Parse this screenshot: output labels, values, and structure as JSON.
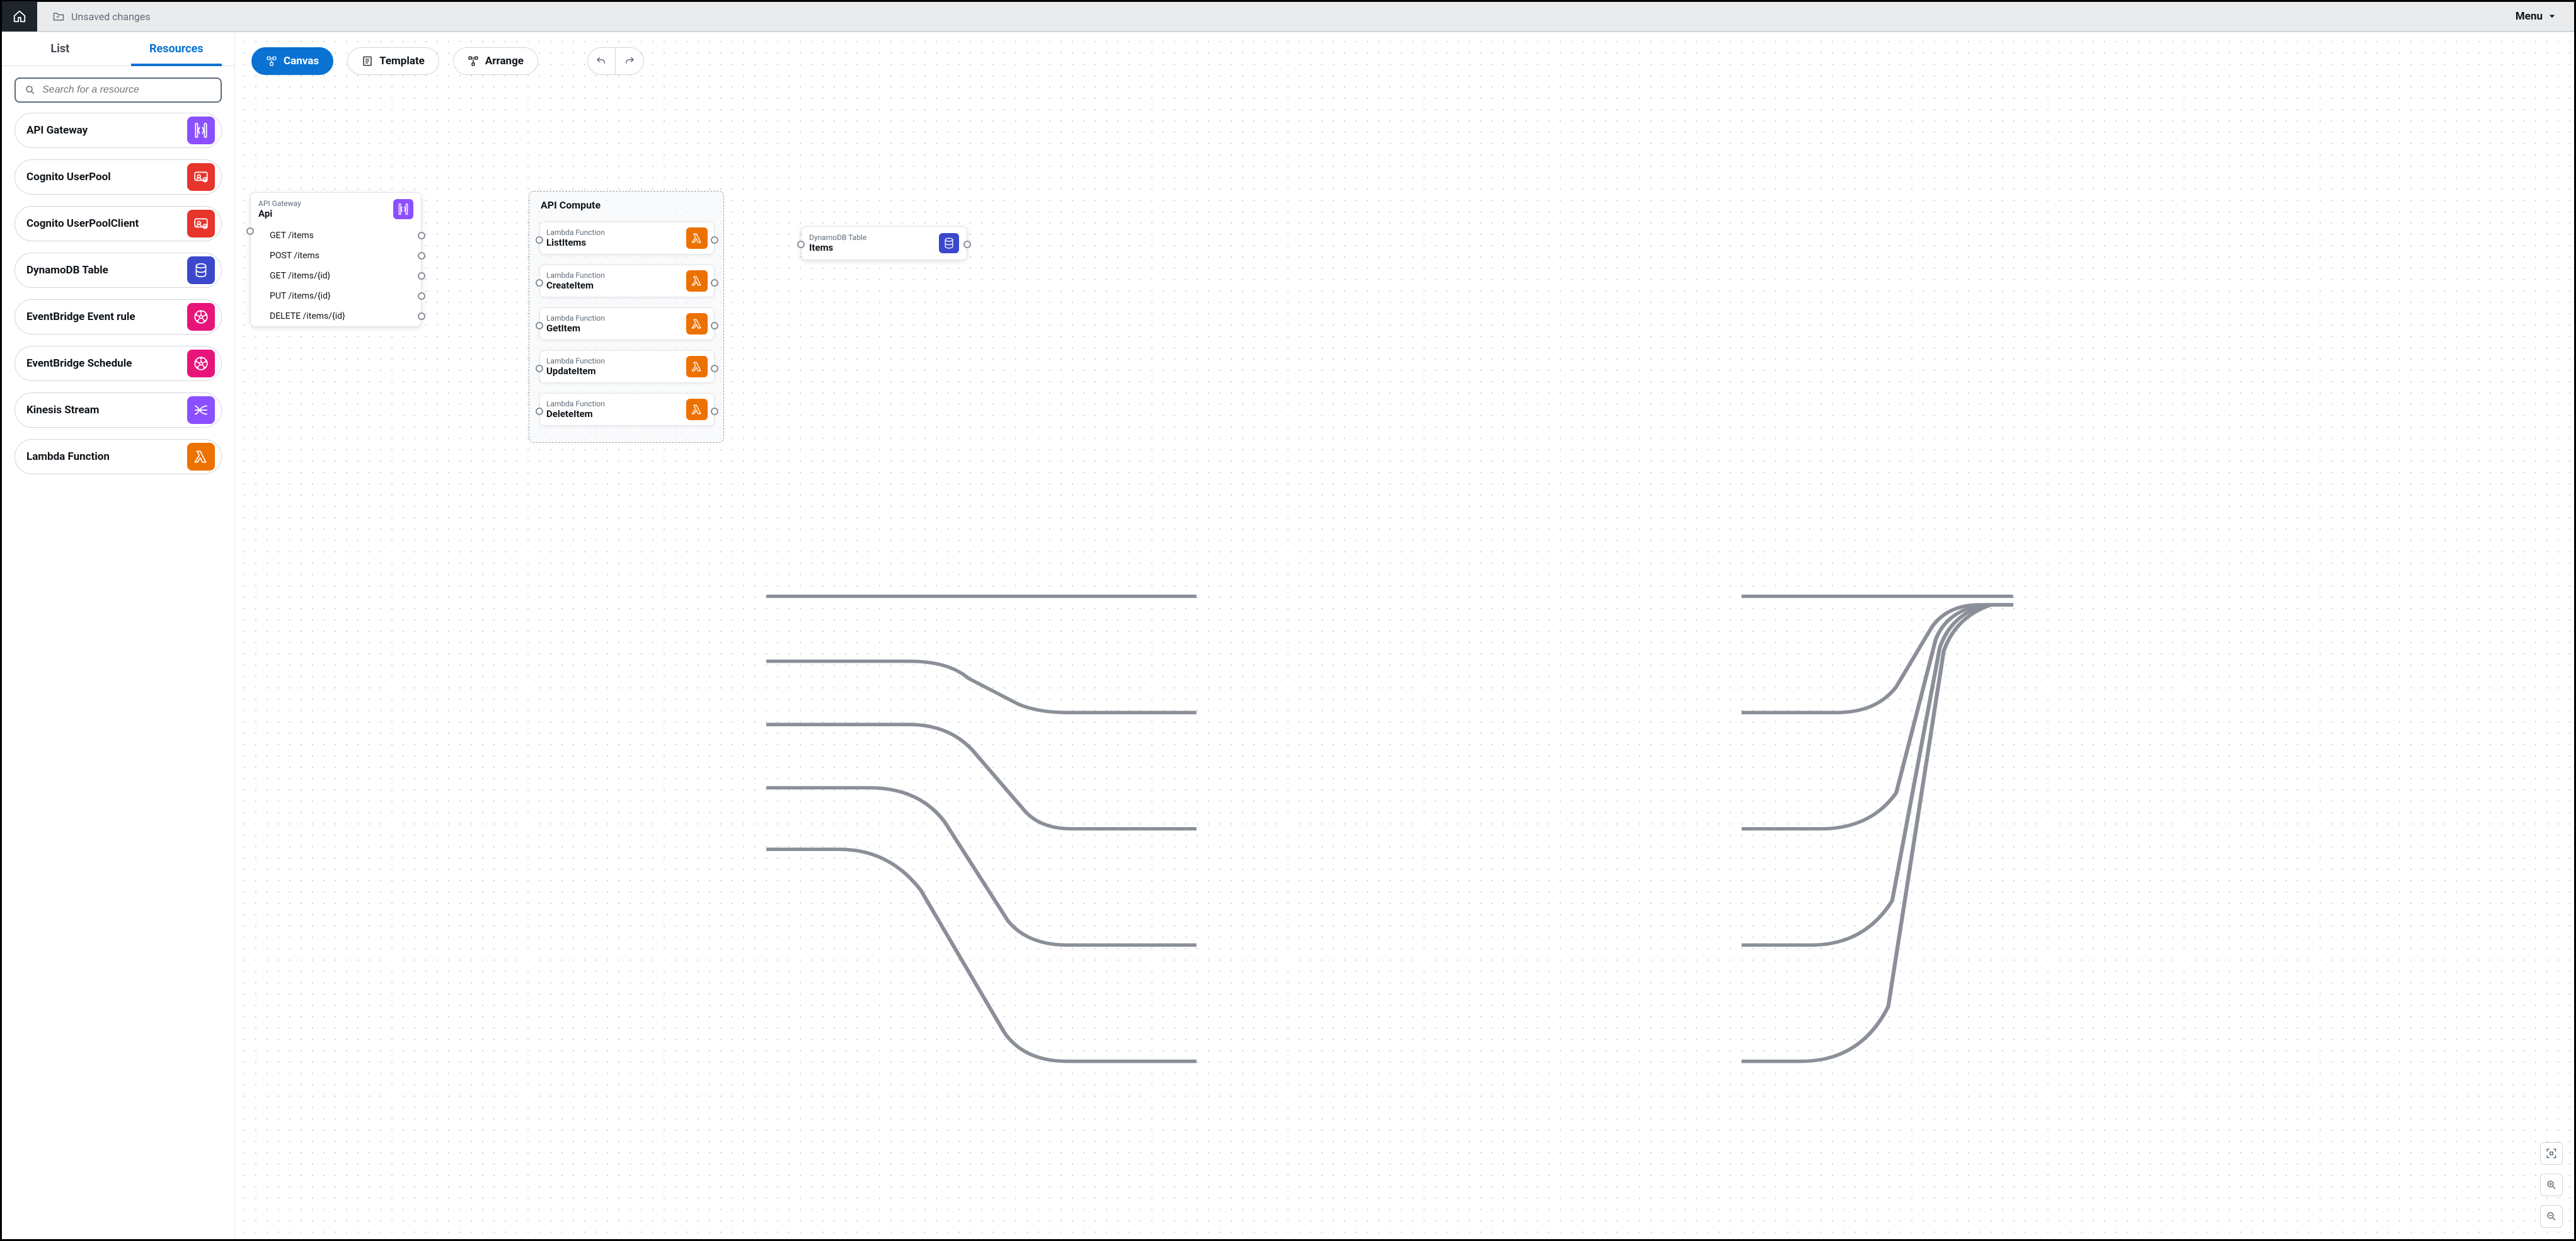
{
  "topbar": {
    "status_text": "Unsaved changes",
    "menu_label": "Menu"
  },
  "sidebar": {
    "tabs": {
      "list": "List",
      "resources": "Resources"
    },
    "search_placeholder": "Search for a resource",
    "items": [
      {
        "label": "API Gateway",
        "icon": "api-gateway-icon",
        "color": "purple"
      },
      {
        "label": "Cognito UserPool",
        "icon": "cognito-icon",
        "color": "red"
      },
      {
        "label": "Cognito UserPoolClient",
        "icon": "cognito-icon",
        "color": "red"
      },
      {
        "label": "DynamoDB Table",
        "icon": "dynamodb-icon",
        "color": "blue"
      },
      {
        "label": "EventBridge Event rule",
        "icon": "eventbridge-icon",
        "color": "pink"
      },
      {
        "label": "EventBridge Schedule",
        "icon": "eventbridge-icon",
        "color": "pink"
      },
      {
        "label": "Kinesis Stream",
        "icon": "kinesis-icon",
        "color": "purple"
      },
      {
        "label": "Lambda Function",
        "icon": "lambda-icon",
        "color": "orange"
      }
    ]
  },
  "toolbar": {
    "canvas": "Canvas",
    "template": "Template",
    "arrange": "Arrange"
  },
  "canvas": {
    "api_node": {
      "type": "API Gateway",
      "name": "Api",
      "routes": [
        "GET /items",
        "POST /items",
        "GET /items/{id}",
        "PUT /items/{id}",
        "DELETE /items/{id}"
      ]
    },
    "compute_group": {
      "title": "API Compute",
      "lambdas": [
        {
          "type": "Lambda Function",
          "name": "ListItems"
        },
        {
          "type": "Lambda Function",
          "name": "CreateItem"
        },
        {
          "type": "Lambda Function",
          "name": "GetItem"
        },
        {
          "type": "Lambda Function",
          "name": "UpdateItem"
        },
        {
          "type": "Lambda Function",
          "name": "DeleteItem"
        }
      ]
    },
    "db_node": {
      "type": "DynamoDB Table",
      "name": "Items"
    }
  }
}
